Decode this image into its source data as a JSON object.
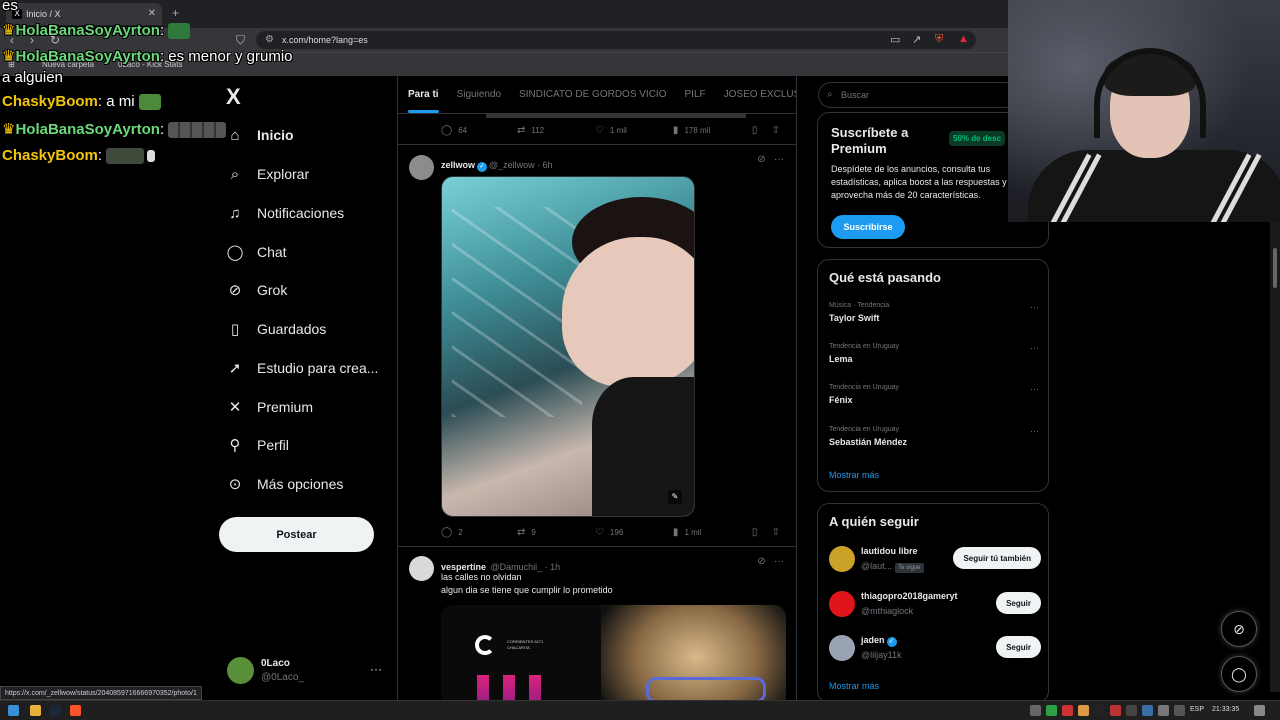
{
  "browser": {
    "tab_title": "Inicio / X",
    "tab_favicon": "X",
    "url": "x.com/home?lang=es",
    "bookmarks": [
      "Nueva carpeta",
      "0Laco - Kick Stats"
    ],
    "status_url": "https://x.com/_zellwow/status/2040859716666970352/photo/1"
  },
  "chat": {
    "lines": [
      {
        "user": "",
        "message": "es"
      },
      {
        "user": "HolaBanaSoyAyrton",
        "message": ""
      },
      {
        "user": "HolaBanaSoyAyrton",
        "message": "es menor y grumio"
      },
      {
        "user": "",
        "message": "a alguien"
      },
      {
        "user": "ChaskyBoom",
        "message": "a mi"
      },
      {
        "user": "HolaBanaSoyAyrton",
        "message": ""
      },
      {
        "user": "ChaskyBoom",
        "message": ""
      }
    ]
  },
  "nav": {
    "logo": "X",
    "items": [
      {
        "label": "Inicio",
        "icon": "home-icon"
      },
      {
        "label": "Explorar",
        "icon": "search-icon"
      },
      {
        "label": "Notificaciones",
        "icon": "bell-icon"
      },
      {
        "label": "Chat",
        "icon": "chat-icon"
      },
      {
        "label": "Grok",
        "icon": "grok-icon"
      },
      {
        "label": "Guardados",
        "icon": "bookmark-icon"
      },
      {
        "label": "Estudio para crea...",
        "icon": "rocket-icon"
      },
      {
        "label": "Premium",
        "icon": "x-icon"
      },
      {
        "label": "Perfil",
        "icon": "person-icon"
      },
      {
        "label": "Más opciones",
        "icon": "more-circle-icon"
      }
    ],
    "post_button": "Postear",
    "account": {
      "name": "0Laco",
      "handle": "@0Laco_"
    }
  },
  "timeline": {
    "tabs": [
      "Para ti",
      "Siguiendo",
      "SINDICATO DE GORDOS VICIO",
      "PILF",
      "JOSEO EXCLUSI"
    ],
    "previous_post_actions": {
      "replies": "64",
      "reposts": "112",
      "likes": "1 mil",
      "views": "178 mil"
    },
    "posts": [
      {
        "name": "zellwow",
        "verified": true,
        "handle": "@_zellwow",
        "time": "6h",
        "text": "",
        "actions": {
          "replies": "2",
          "reposts": "9",
          "likes": "196",
          "views": "1 mil"
        }
      },
      {
        "name": "vespertine",
        "verified": false,
        "handle": "@Damuchii_",
        "time": "1h",
        "text_lines": [
          "las calles no olvidan",
          "algun dia se tiene que cumplir lo prometido"
        ],
        "image_text": {
          "line1": "CORRIENTES 6271",
          "line2": "CHACARITA"
        }
      }
    ]
  },
  "sidebar": {
    "search_placeholder": "Buscar",
    "premium": {
      "title": "Suscríbete a Premium",
      "badge": "50% de desc",
      "description": "Despídete de los anuncios, consulta tus estadísticas, aplica boost a las respuestas y aprovecha más de 20 características.",
      "button": "Suscribirse"
    },
    "trends": {
      "title": "Qué está pasando",
      "items": [
        {
          "context": "Música · Tendencia",
          "topic": "Taylor Swift"
        },
        {
          "context": "Tendencia en Uruguay",
          "topic": "Lema"
        },
        {
          "context": "Tendencia en Uruguay",
          "topic": "Fénix"
        },
        {
          "context": "Tendencia en Uruguay",
          "topic": "Sebastián Méndez"
        }
      ],
      "show_more": "Mostrar más"
    },
    "who_to_follow": {
      "title": "A quién seguir",
      "items": [
        {
          "name": "lautidou libre",
          "handle": "@laut...",
          "follows_you": "Te sigue",
          "button": "Seguir tú también"
        },
        {
          "name": "thiagopro2018gameryt",
          "handle": "@mthiaglock",
          "button": "Seguir"
        },
        {
          "name": "jaden",
          "handle": "@liljay11k",
          "verified": true,
          "button": "Seguir"
        }
      ],
      "show_more": "Mostrar más"
    }
  },
  "taskbar": {
    "lang": "ESP",
    "time": "21:33:35"
  },
  "colors": {
    "accent": "#1d9bf0",
    "background": "#000000",
    "border": "#2f3336",
    "muted": "#71767b"
  }
}
